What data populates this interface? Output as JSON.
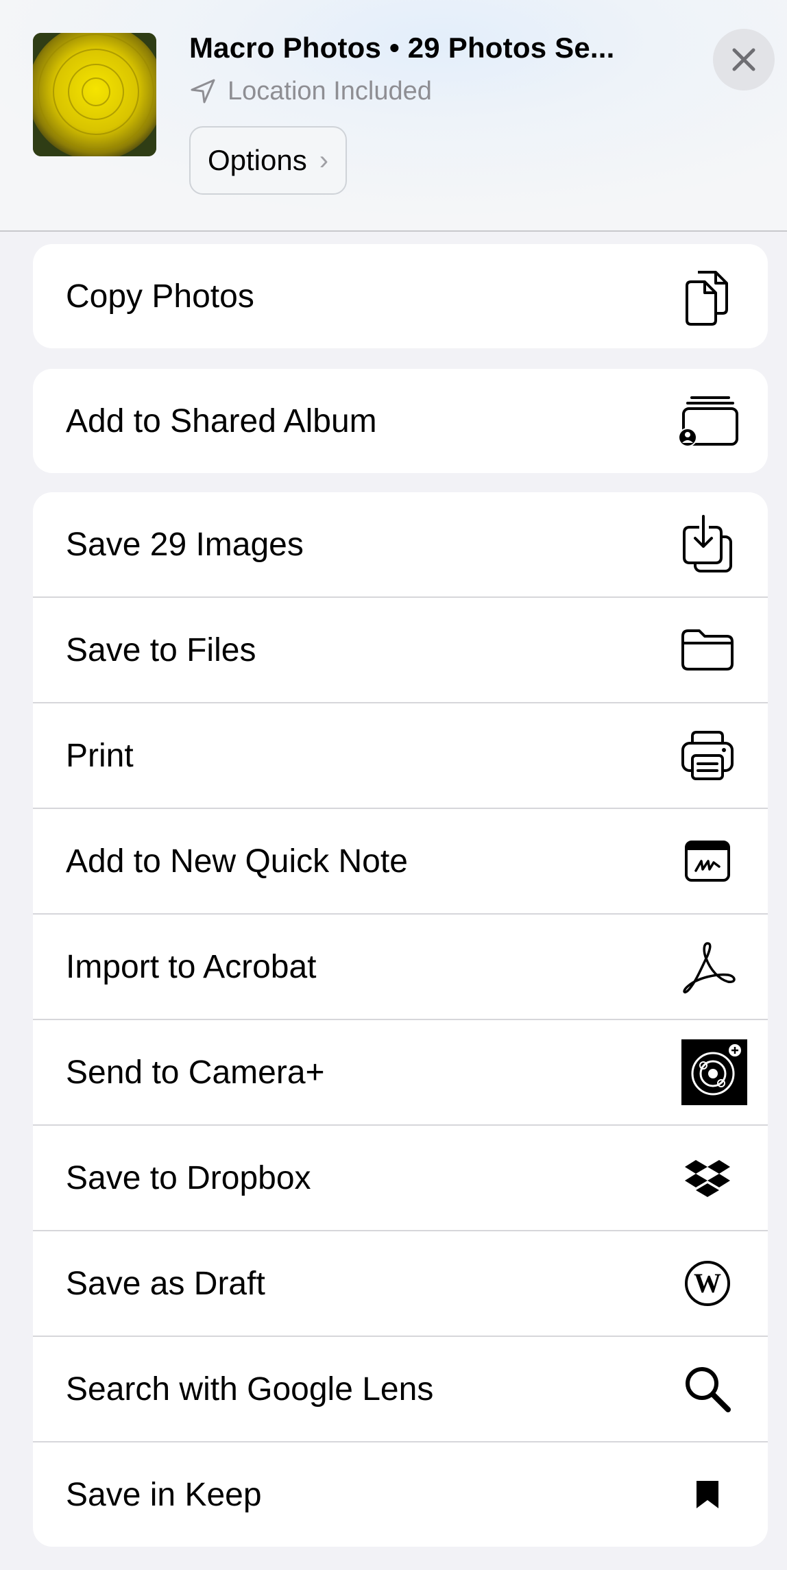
{
  "header": {
    "title": "Macro Photos • 29 Photos Se...",
    "location": "Location Included",
    "options_label": "Options",
    "options_chevron": "›"
  },
  "card1": {
    "label": "Copy Photos",
    "icon": "copy-icon"
  },
  "card2": {
    "label": "Add to Shared Album",
    "icon": "shared-album-icon"
  },
  "actions": [
    {
      "label": "Save 29 Images",
      "icon": "save-images-icon"
    },
    {
      "label": "Save to Files",
      "icon": "folder-icon"
    },
    {
      "label": "Print",
      "icon": "printer-icon"
    },
    {
      "label": "Add to New Quick Note",
      "icon": "quick-note-icon"
    },
    {
      "label": "Import to Acrobat",
      "icon": "acrobat-icon"
    },
    {
      "label": "Send to Camera+",
      "icon": "camera-plus-icon"
    },
    {
      "label": "Save to Dropbox",
      "icon": "dropbox-icon"
    },
    {
      "label": "Save as Draft",
      "icon": "wordpress-icon"
    },
    {
      "label": "Search with Google Lens",
      "icon": "search-icon"
    },
    {
      "label": "Save in Keep",
      "icon": "bookmark-icon"
    }
  ]
}
